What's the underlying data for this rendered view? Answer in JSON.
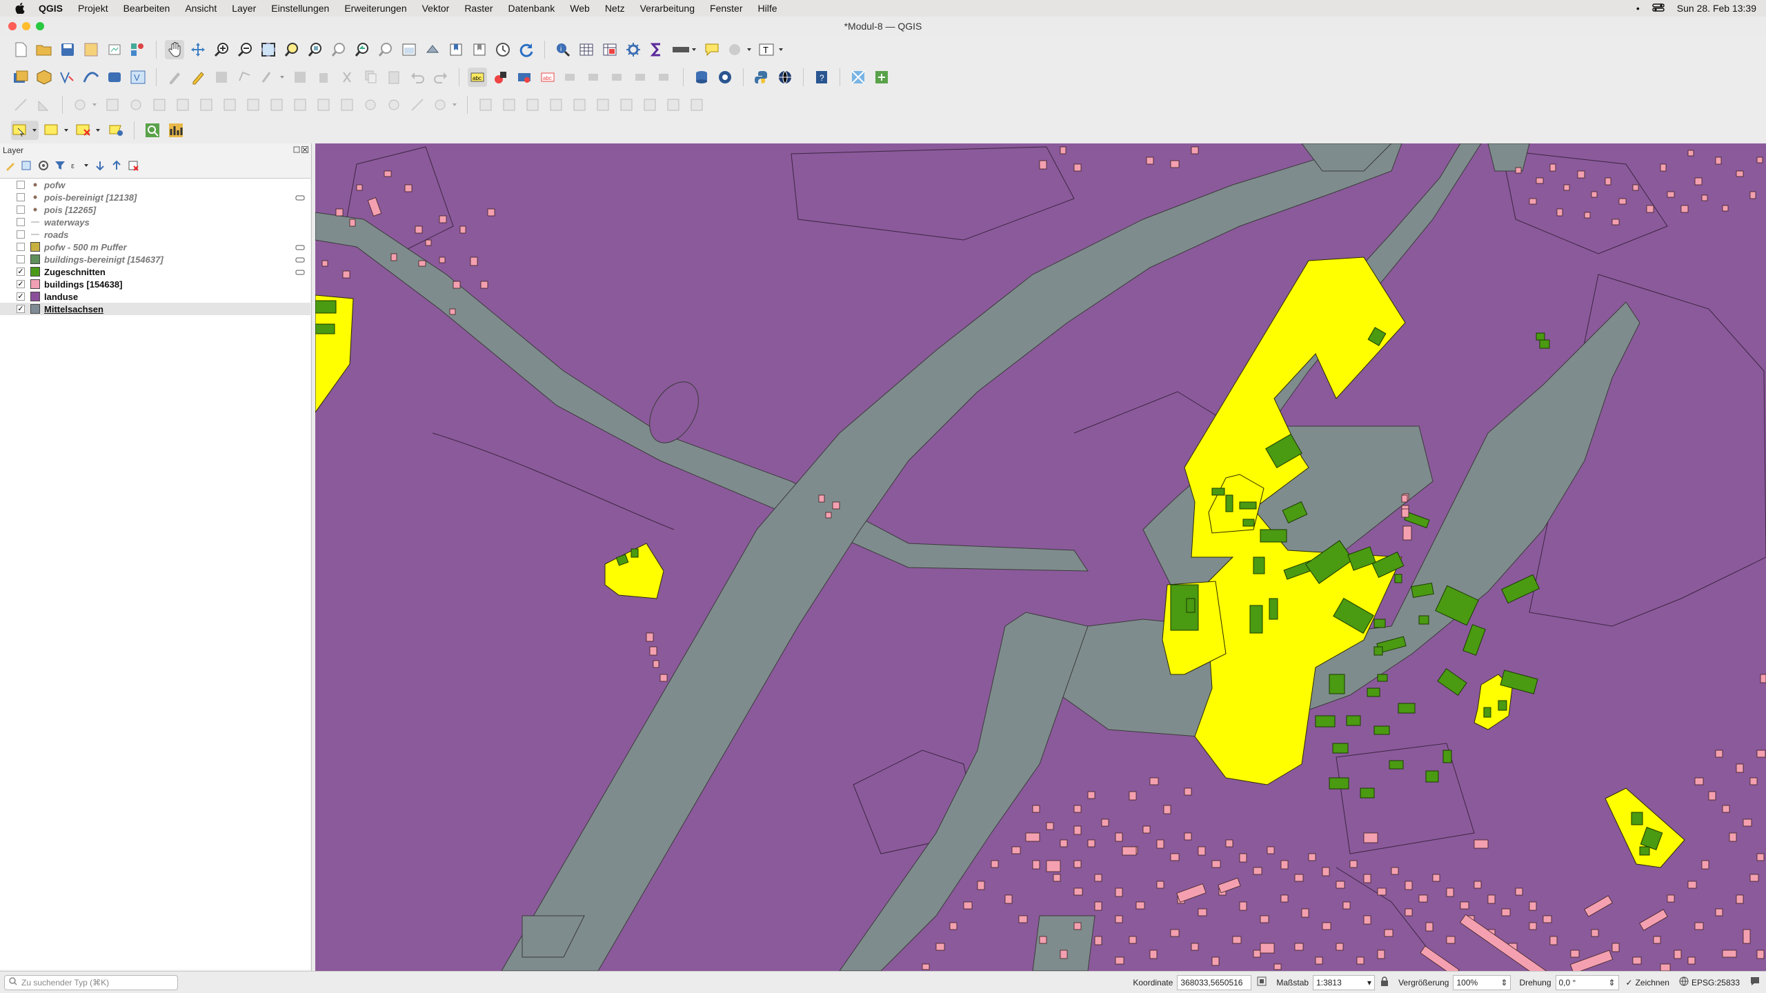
{
  "menubar": {
    "app": "QGIS",
    "items": [
      "Projekt",
      "Bearbeiten",
      "Ansicht",
      "Layer",
      "Einstellungen",
      "Erweiterungen",
      "Vektor",
      "Raster",
      "Datenbank",
      "Web",
      "Netz",
      "Verarbeitung",
      "Fenster",
      "Hilfe"
    ],
    "datetime": "Sun 28. Feb  13:39"
  },
  "window": {
    "title": "*Modul-8 — QGIS"
  },
  "layers_panel": {
    "title": "Layer",
    "layers": [
      {
        "name": "pofw",
        "visible": false,
        "symbol": "point",
        "color": "#8a6d5a"
      },
      {
        "name": "pois-bereinigt [12138]",
        "visible": false,
        "symbol": "point",
        "color": "#8a6d5a"
      },
      {
        "name": "pois [12265]",
        "visible": false,
        "symbol": "point",
        "color": "#8a6d5a"
      },
      {
        "name": "waterways",
        "visible": false,
        "symbol": "line",
        "color": "#9a9a9a"
      },
      {
        "name": "roads",
        "visible": false,
        "symbol": "line",
        "color": "#9a9a9a"
      },
      {
        "name": "pofw - 500 m Puffer",
        "visible": false,
        "symbol": "fill",
        "color": "#c8b040"
      },
      {
        "name": "buildings-bereinigt [154637]",
        "visible": false,
        "symbol": "fill",
        "color": "#5f8f5a"
      },
      {
        "name": "Zugeschnitten",
        "visible": true,
        "symbol": "fill",
        "color": "#4a9a1a"
      },
      {
        "name": "buildings [154638]",
        "visible": true,
        "symbol": "fill",
        "color": "#f0a0b4"
      },
      {
        "name": "landuse",
        "visible": true,
        "symbol": "fill",
        "color": "#8b4f9a"
      },
      {
        "name": "Mittelsachsen",
        "visible": true,
        "symbol": "fill",
        "color": "#7f8c96",
        "selected": true
      }
    ]
  },
  "map": {
    "colors": {
      "landuse": "#8b5a9b",
      "mittelsachsen": "#7f8c8d",
      "buffer": "#ffff00",
      "clipped": "#4a9a12",
      "buildings": "#f4a0b0"
    }
  },
  "statusbar": {
    "search_placeholder": "Zu suchender Typ (⌘K)",
    "coordinate_label": "Koordinate",
    "coordinate": "368033,5650516",
    "scale_label": "Maßstab",
    "scale": "1:3813",
    "magnifier_label": "Vergrößerung",
    "magnifier": "100%",
    "rotation_label": "Drehung",
    "rotation": "0,0 °",
    "render_label": "Zeichnen",
    "crs": "EPSG:25833"
  }
}
